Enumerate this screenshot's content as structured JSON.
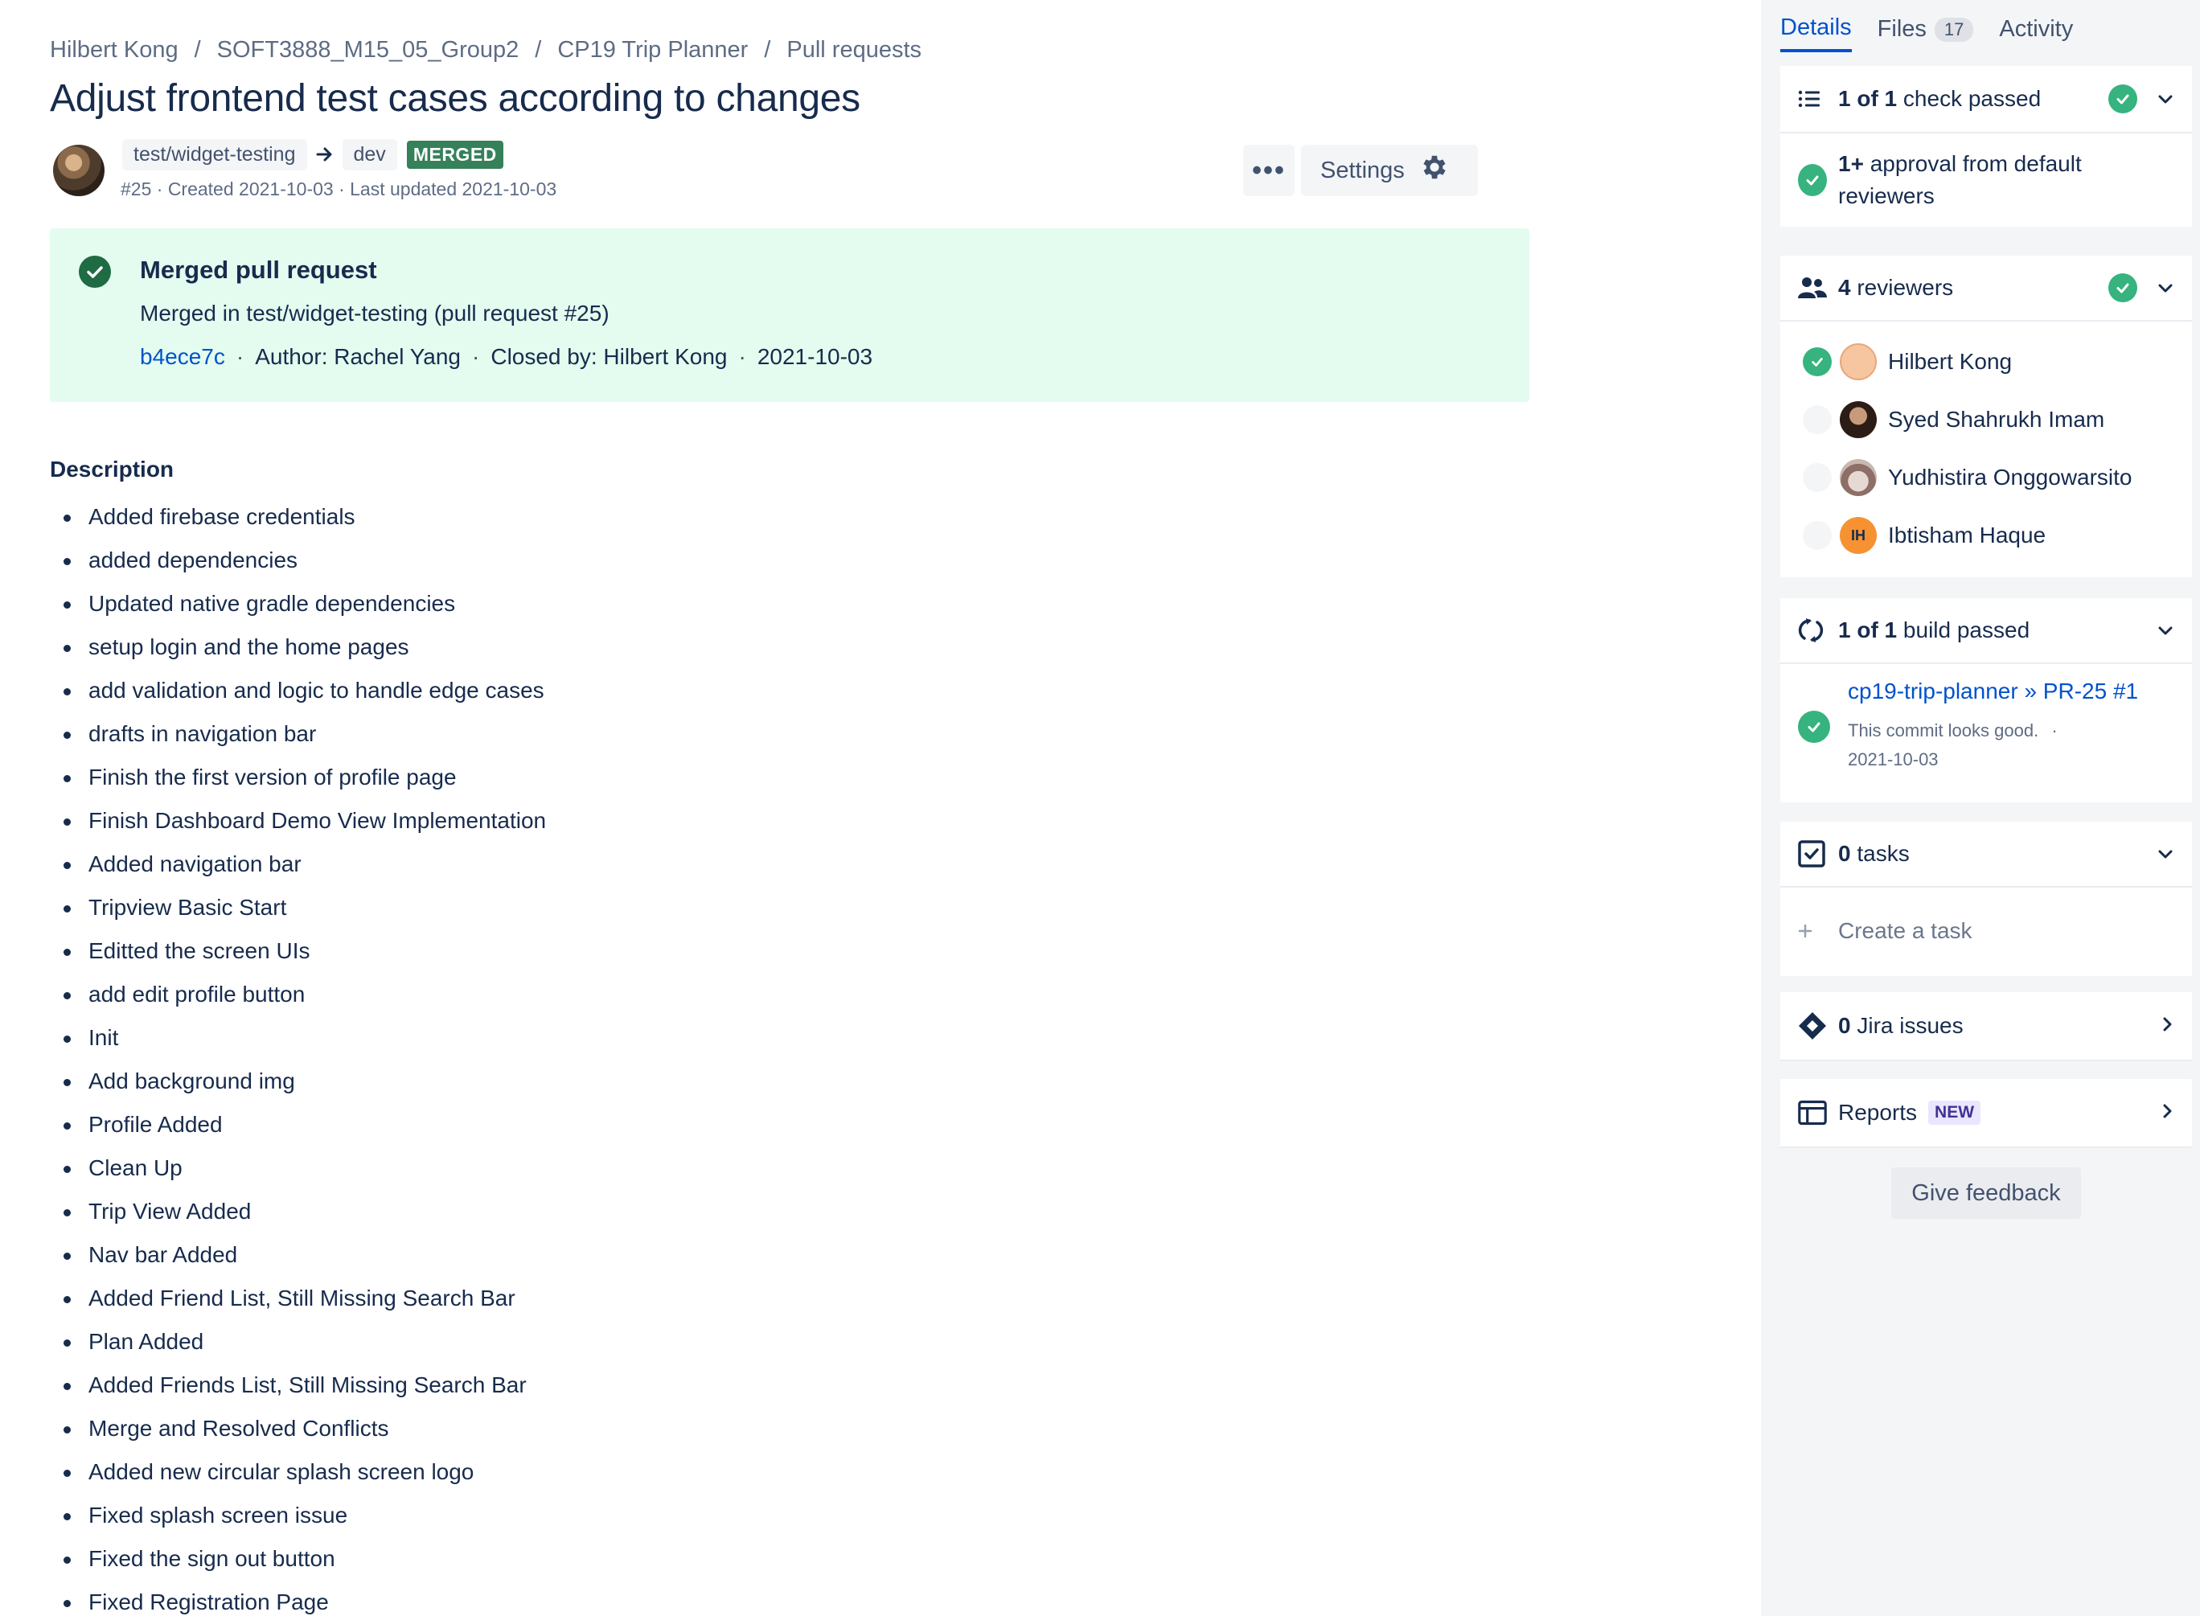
{
  "breadcrumb": [
    "Hilbert Kong",
    "SOFT3888_M15_05_Group2",
    "CP19 Trip Planner",
    "Pull requests"
  ],
  "breadcrumb_separator": "/",
  "title": "Adjust frontend test cases according to changes",
  "pr": {
    "source_branch": "test/widget-testing",
    "target_branch": "dev",
    "status": "MERGED",
    "meta": "#25 · Created 2021-10-03 · Last updated 2021-10-03"
  },
  "actions": {
    "more_label": "•••",
    "settings_label": "Settings"
  },
  "merge_banner": {
    "title": "Merged pull request",
    "message": "Merged in test/widget-testing (pull request #25)",
    "commit": "b4ece7c",
    "author": "Author: Rachel Yang",
    "closed_by": "Closed by: Hilbert Kong",
    "date": "2021-10-03",
    "dot": "·"
  },
  "description": {
    "heading": "Description",
    "items": [
      "Added firebase credentials",
      "added dependencies",
      "Updated native gradle dependencies",
      "setup login and the home pages",
      "add validation and logic to handle edge cases",
      "drafts in navigation bar",
      "Finish the first version of profile page",
      "Finish Dashboard Demo View Implementation",
      "Added navigation bar",
      "Tripview Basic Start",
      "Editted the screen UIs",
      "add edit profile button",
      "Init",
      "Add background img",
      "Profile Added",
      "Clean Up",
      "Trip View Added",
      "Nav bar Added",
      "Added Friend List, Still Missing Search Bar",
      "Plan Added",
      "Added Friends List, Still Missing Search Bar",
      "Merge and Resolved Conflicts",
      "Added new circular splash screen logo",
      "Fixed splash screen issue",
      "Fixed the sign out button",
      "Fixed Registration Page"
    ]
  },
  "sidebar": {
    "tabs": [
      {
        "label": "Details",
        "active": true
      },
      {
        "label": "Files",
        "count": "17"
      },
      {
        "label": "Activity"
      }
    ],
    "checks": {
      "count": "1 of 1",
      "label": "check passed"
    },
    "approval": {
      "count": "1+",
      "label": "approval from default reviewers"
    },
    "reviewers": {
      "count": "4",
      "label": "reviewers",
      "list": [
        {
          "name": "Hilbert Kong",
          "approved": true,
          "avatar_color": "#f5c6a0"
        },
        {
          "name": "Syed Shahrukh Imam",
          "approved": false,
          "avatar_color": "#3b2a22"
        },
        {
          "name": "Yudhistira Onggowarsito",
          "approved": false,
          "avatar_color": "#b9a7a0"
        },
        {
          "name": "Ibtisham Haque",
          "approved": false,
          "avatar_color": "#f79232",
          "initials": "IH"
        }
      ]
    },
    "builds": {
      "count": "1 of 1",
      "label": "build passed",
      "link": "cp19-trip-planner » PR-25 #1",
      "status_text": "This commit looks good.",
      "dot": "·",
      "date": "2021-10-03"
    },
    "tasks": {
      "count": "0",
      "label": "tasks",
      "create_label": "Create a task"
    },
    "jira": {
      "count": "0",
      "label": "Jira issues"
    },
    "reports": {
      "label": "Reports",
      "badge": "NEW"
    },
    "feedback_label": "Give feedback"
  },
  "colors": {
    "accent": "#0052cc",
    "success": "#36b37e",
    "merged": "#36805a",
    "banner_bg": "#e3fcef",
    "sidebar_bg": "#f4f5f7"
  },
  "icons": [
    "check-circle-icon",
    "gear-icon",
    "more-icon",
    "checklist-icon",
    "reviewers-icon",
    "build-icon",
    "task-checkbox-icon",
    "jira-icon",
    "reports-icon",
    "plus-icon",
    "chevron-down-icon",
    "chevron-right-icon",
    "arrow-right-icon"
  ]
}
